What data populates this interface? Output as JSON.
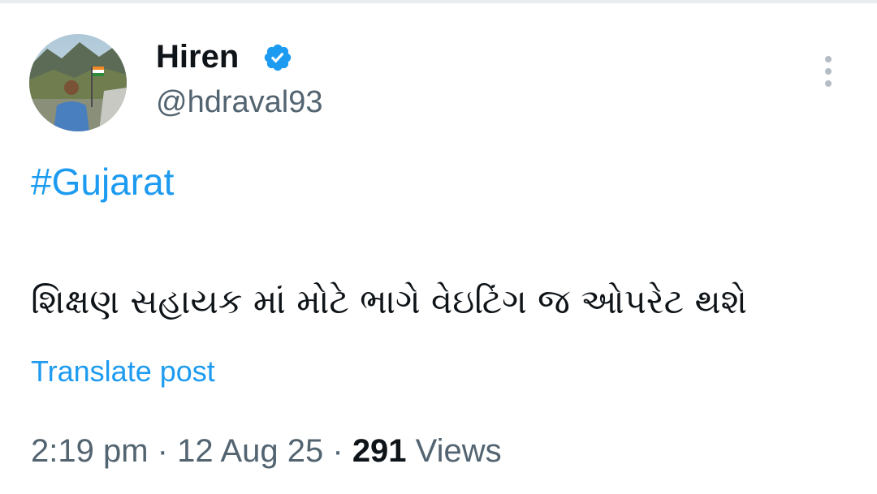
{
  "author": {
    "display_name": "Hiren",
    "handle": "@hdraval93",
    "verified": true,
    "verified_icon": "verified-badge-icon",
    "avatar_icon": "profile-photo"
  },
  "more_menu_icon": "vertical-dots-icon",
  "post": {
    "hashtag": "#Gujarat",
    "text": "શિક્ષણ સહાયક માં મોટે ભાગે વેઇટિંગ જ ઓપરેટ થશે",
    "translate_label": "Translate post"
  },
  "meta": {
    "time": "2:19 pm",
    "separator": " · ",
    "date": "12 Aug 25",
    "views_count": "291",
    "views_label": " Views"
  },
  "colors": {
    "link": "#1d9bf0",
    "verified": "#1d9bf0",
    "primary_text": "#0f1419",
    "secondary_text": "#536471"
  }
}
